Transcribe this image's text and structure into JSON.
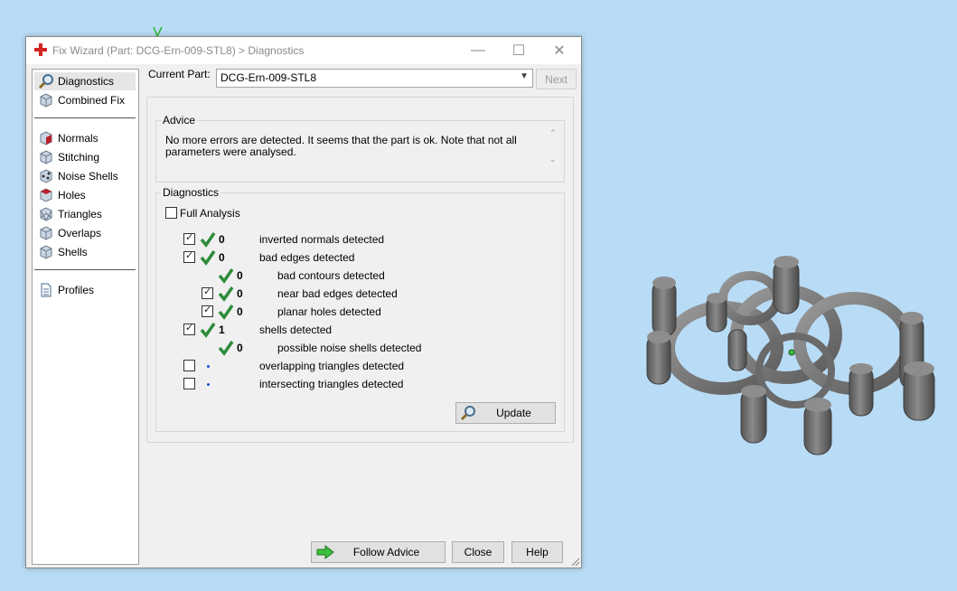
{
  "window": {
    "title": "Fix Wizard (Part: DCG-Ern-009-STL8) > Diagnostics",
    "controls": {
      "minimize": "—",
      "maximize": "☐",
      "close": "✕"
    }
  },
  "sidebar": {
    "items": [
      {
        "label": "Diagnostics",
        "icon": "magnifier-icon"
      },
      {
        "label": "Combined Fix",
        "icon": "cube-icon"
      },
      {
        "label": "Normals",
        "icon": "normals-cube-icon"
      },
      {
        "label": "Stitching",
        "icon": "stitching-cube-icon"
      },
      {
        "label": "Noise Shells",
        "icon": "noise-shells-cube-icon"
      },
      {
        "label": "Holes",
        "icon": "holes-cube-icon"
      },
      {
        "label": "Triangles",
        "icon": "triangles-cube-icon"
      },
      {
        "label": "Overlaps",
        "icon": "overlaps-cube-icon"
      },
      {
        "label": "Shells",
        "icon": "shells-cube-icon"
      },
      {
        "label": "Profiles",
        "icon": "document-icon"
      }
    ]
  },
  "current_part": {
    "label": "Current Part:",
    "value": "DCG-Ern-009-STL8"
  },
  "next_button": "Next",
  "advice": {
    "title": "Advice",
    "line1": "No more errors are detected. It seems that the part is ok. Note that not all",
    "line2": "parameters were analysed."
  },
  "diagnostics": {
    "title": "Diagnostics",
    "full_analysis_label": "Full Analysis",
    "rows": [
      {
        "count": "0",
        "label": "inverted normals detected"
      },
      {
        "count": "0",
        "label": "bad edges detected"
      },
      {
        "count": "0",
        "label": "bad contours detected"
      },
      {
        "count": "0",
        "label": "near bad edges detected"
      },
      {
        "count": "0",
        "label": "planar holes detected"
      },
      {
        "count": "1",
        "label": "shells detected"
      },
      {
        "count": "0",
        "label": "possible noise shells detected"
      },
      {
        "count": "",
        "label": "overlapping triangles detected"
      },
      {
        "count": "",
        "label": "intersecting triangles detected"
      }
    ],
    "update_button": "Update"
  },
  "footer": {
    "follow_advice": "Follow Advice",
    "close": "Close",
    "help": "Help"
  },
  "colors": {
    "accent_check": "#2e8b3a",
    "desktop": "#b9dcf6",
    "model": "#6f6f6f"
  }
}
